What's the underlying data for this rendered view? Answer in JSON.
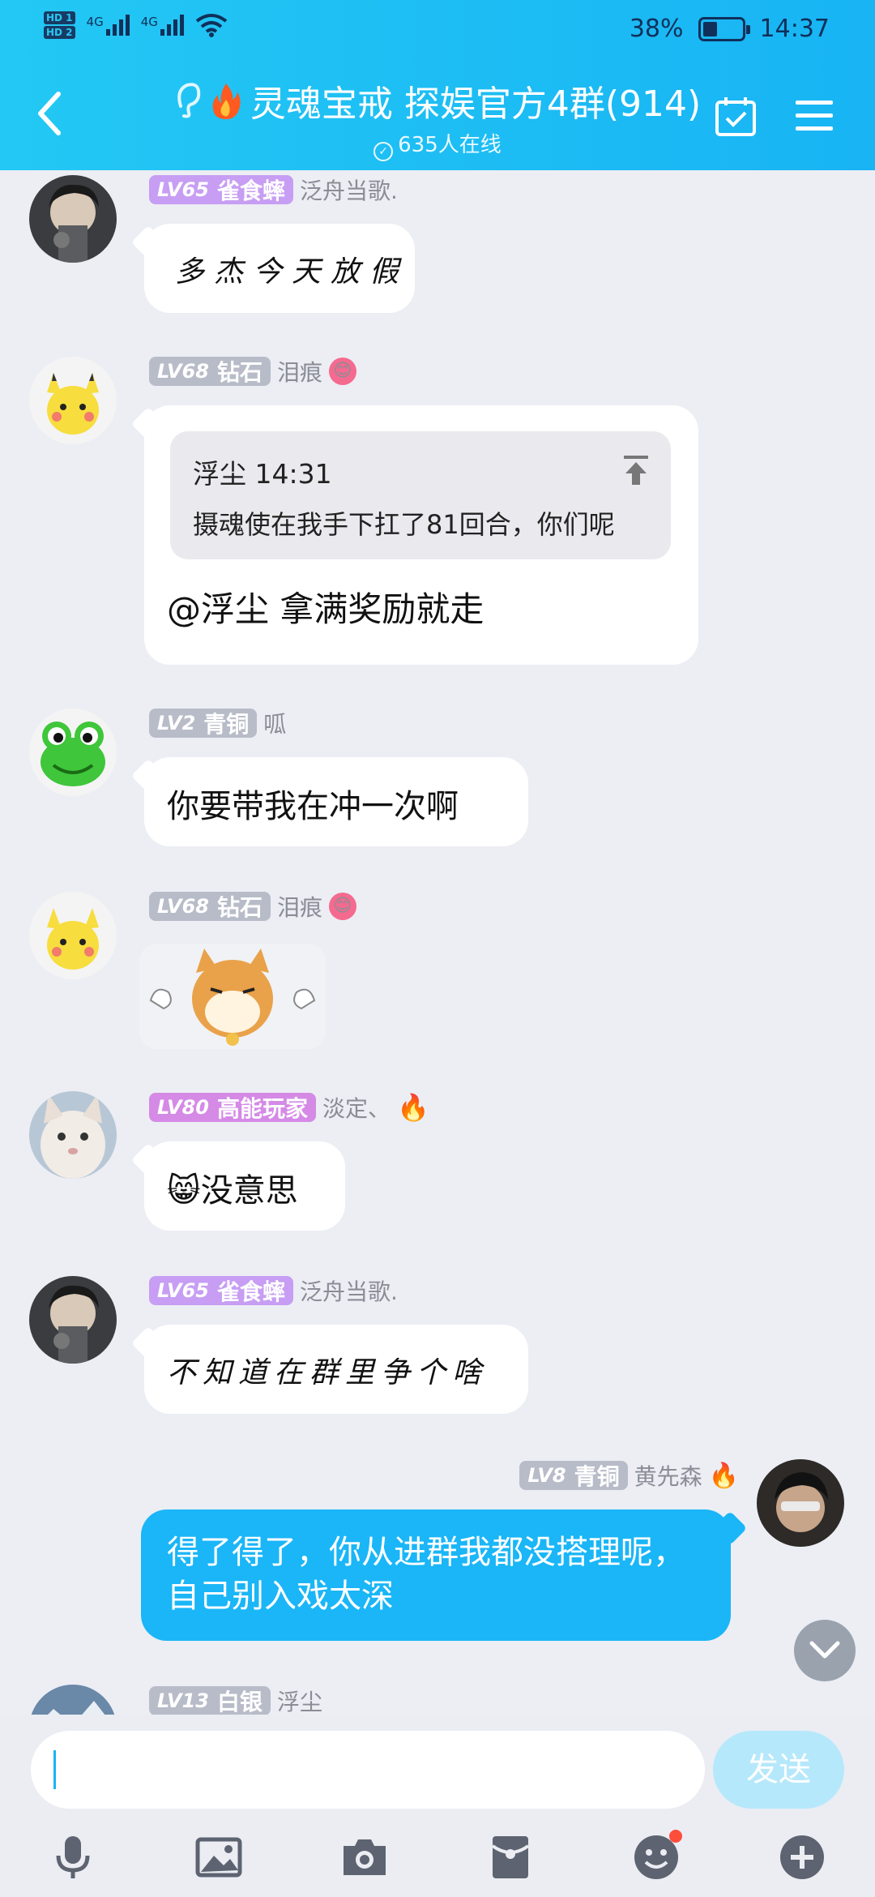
{
  "status_bar": {
    "hd1": "HD 1",
    "hd2": "HD 2",
    "net1": "4G",
    "net2": "4G",
    "battery": "38%",
    "battery_level": 0.38,
    "time": "14:37"
  },
  "header": {
    "title": "灵魂宝戒 探娱官方4群(914)",
    "online": "635人在线"
  },
  "messages": [
    {
      "level": "LV65",
      "title": "雀食蟀",
      "name": "泛舟当歌.",
      "text": "多杰今天放假"
    },
    {
      "level": "LV68",
      "title": "钻石",
      "name": "泪痕",
      "quote": {
        "header": "浮尘 14:31",
        "body": "摄魂使在我手下扛了81回合，你们呢"
      },
      "text": "@浮尘 拿满奖励就走"
    },
    {
      "level": "LV2",
      "title": "青铜",
      "name": "呱",
      "text": "你要带我在冲一次啊"
    },
    {
      "level": "LV68",
      "title": "钻石",
      "name": "泪痕"
    },
    {
      "level": "LV80",
      "title": "高能玩家",
      "name": "淡定、",
      "text": "没意思"
    },
    {
      "level": "LV65",
      "title": "雀食蟀",
      "name": "泛舟当歌.",
      "text": "不知道在群里争个啥"
    },
    {
      "level": "LV8",
      "title": "青铜",
      "name": "黄先森",
      "text": "得了得了，你从进群我都没搭理呢，自己别入戏太深"
    },
    {
      "level": "LV13",
      "title": "白银",
      "name": "浮尘"
    }
  ],
  "input": {
    "placeholder": "",
    "send_label": "发送"
  },
  "colors": {
    "header": "#18b4f4",
    "my_bubble": "#1ab6f7",
    "background": "#eceef4"
  }
}
